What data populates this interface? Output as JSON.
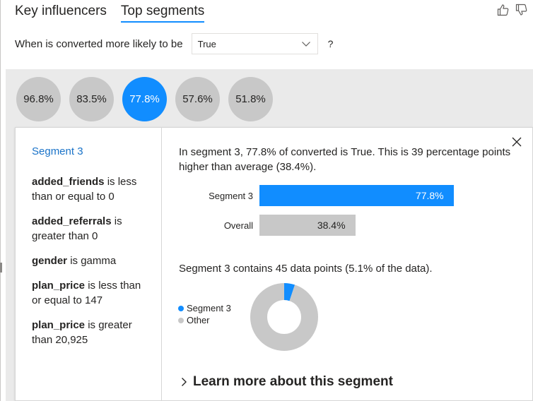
{
  "tabs": [
    {
      "label": "Key influencers",
      "active": false
    },
    {
      "label": "Top segments",
      "active": true
    }
  ],
  "question": {
    "prefix": "When is converted more likely to be",
    "dropdown_value": "True",
    "help": "?"
  },
  "bubbles": [
    {
      "label": "96.8%",
      "selected": false
    },
    {
      "label": "83.5%",
      "selected": false
    },
    {
      "label": "77.8%",
      "selected": true
    },
    {
      "label": "57.6%",
      "selected": false
    },
    {
      "label": "51.8%",
      "selected": false
    }
  ],
  "segment": {
    "title": "Segment 3",
    "rules": [
      {
        "field": "added_friends",
        "text": "is less than or equal to 0"
      },
      {
        "field": "added_referrals",
        "text": "is greater than 0"
      },
      {
        "field": "gender",
        "text": "is gamma"
      },
      {
        "field": "plan_price",
        "text": "is less than or equal to 147"
      },
      {
        "field": "plan_price",
        "text": "is greater than 20,925"
      }
    ]
  },
  "detail": {
    "description": "In segment 3, 77.8% of converted is True. This is 39 percentage points higher than average (38.4%).",
    "contains": "Segment 3 contains 45 data points (5.1% of the data).",
    "learn_more": "Learn more about this segment"
  },
  "chart_data": [
    {
      "type": "bar",
      "categories": [
        "Segment 3",
        "Overall"
      ],
      "values": [
        77.8,
        38.4
      ],
      "value_labels": [
        "77.8%",
        "38.4%"
      ],
      "xlim": [
        0,
        100
      ]
    },
    {
      "type": "pie",
      "donut": true,
      "categories": [
        "Segment 3",
        "Other"
      ],
      "values": [
        5.1,
        94.9
      ]
    }
  ],
  "colors": {
    "accent": "#118dff",
    "neutral": "#c8c8c8"
  },
  "icons": {
    "like": "thumbs-up-icon",
    "dislike": "thumbs-down-icon",
    "close": "close-icon",
    "dropdown": "chevron-down-icon",
    "expand": "chevron-right-icon"
  }
}
